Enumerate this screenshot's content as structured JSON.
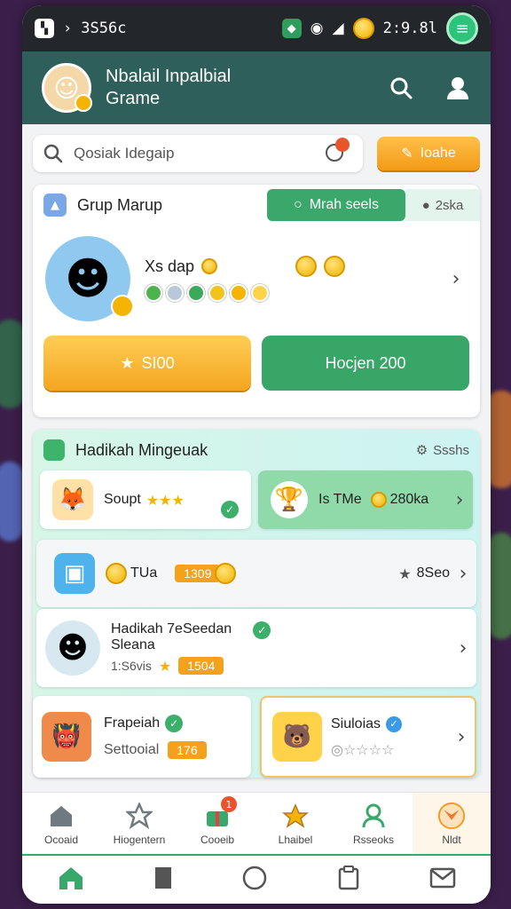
{
  "status_bar": {
    "left_text": "3S56c",
    "time": "2:9.8l"
  },
  "app_bar": {
    "title_line1": "Nbalail Inpalbial",
    "title_line2": "Grame"
  },
  "search": {
    "placeholder": "Qosiak Idegaip",
    "button_label": "Ioahe"
  },
  "group_card": {
    "title": "Grup Marup",
    "tab_active": "Mrah seels",
    "tab_inactive": "2ska",
    "profile_name": "Xs dap",
    "btn_left": "SI00",
    "btn_right": "Hocjen 200"
  },
  "gift_card": {
    "title": "Hadikah Mingeuak",
    "right_label": "Ssshs",
    "tiles": [
      {
        "title": "Soupt"
      },
      {
        "title": "Is TMe",
        "value": "280ka"
      },
      {
        "title": "TUa",
        "pill": "1309",
        "right": "8Seo"
      },
      {
        "title": "Hadikah 7eSeedan",
        "subtitle": "Sleana",
        "meta": "1:S6vis",
        "pill": "1504"
      },
      {
        "title": "Frapeiah",
        "subtitle": "Settooial",
        "pill": "176"
      },
      {
        "title": "Siuloias"
      }
    ]
  },
  "bottom_nav": [
    {
      "label": "Ocoaid",
      "icon": "home-icon"
    },
    {
      "label": "Hiogentern",
      "icon": "star-icon"
    },
    {
      "label": "Cooeib",
      "icon": "gift-icon",
      "badge": "1"
    },
    {
      "label": "Lhaibel",
      "icon": "trophy-icon"
    },
    {
      "label": "Rsseoks",
      "icon": "profile-icon"
    },
    {
      "label": "Nldt",
      "icon": "fox-icon"
    }
  ],
  "colors": {
    "teal_header": "#2e5f5b",
    "green": "#3aa86b",
    "orange": "#f4a21c"
  }
}
